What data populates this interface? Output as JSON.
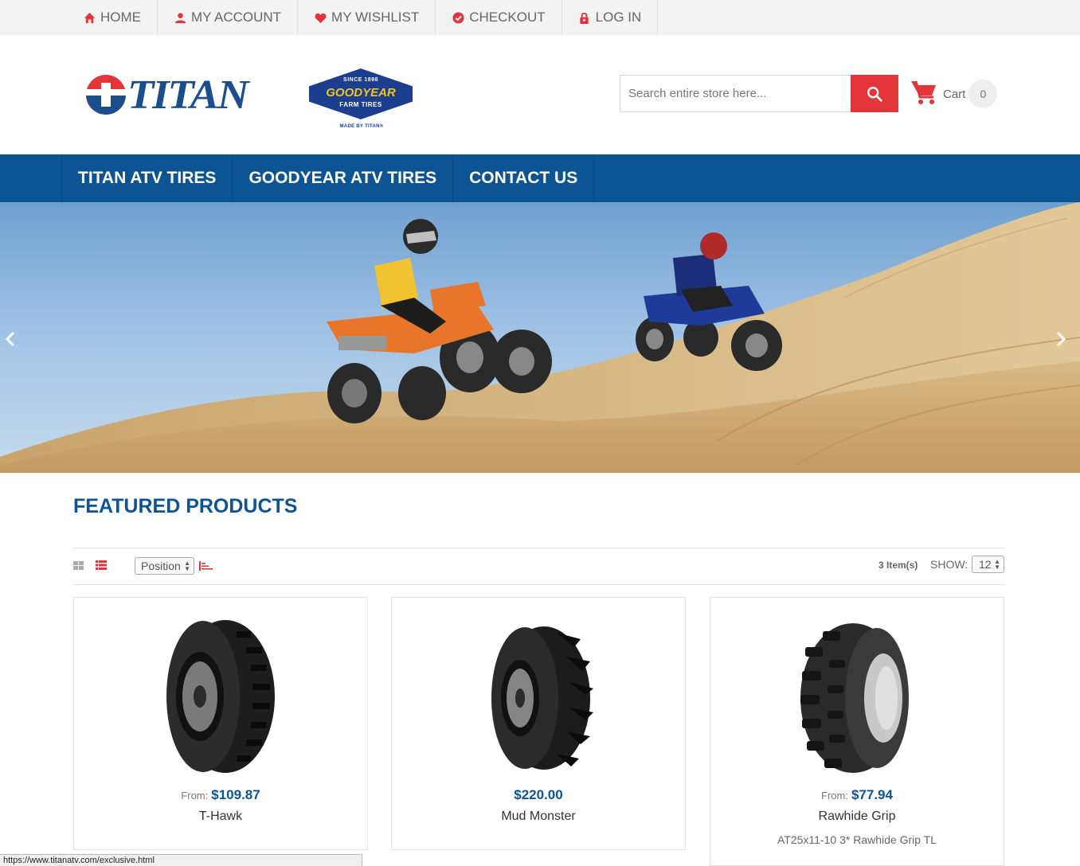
{
  "top_links": [
    {
      "label": "HOME",
      "icon": "home-icon"
    },
    {
      "label": "MY ACCOUNT",
      "icon": "user-icon"
    },
    {
      "label": "MY WISHLIST",
      "icon": "heart-icon"
    },
    {
      "label": "CHECKOUT",
      "icon": "check-circle-icon"
    },
    {
      "label": "LOG IN",
      "icon": "lock-icon"
    }
  ],
  "brand": {
    "titan_logo_text": "TITAN",
    "goodyear_since": "SINCE 1898",
    "goodyear_name": "GOODYEAR",
    "goodyear_farm": "FARM TIRES",
    "goodyear_made_by": "MADE BY TITAN®"
  },
  "search": {
    "placeholder": "Search entire store here...",
    "value": ""
  },
  "cart": {
    "label": "Cart",
    "count": "0"
  },
  "nav": [
    {
      "label": "TITAN ATV TIRES"
    },
    {
      "label": "GOODYEAR ATV TIRES"
    },
    {
      "label": "CONTACT US"
    }
  ],
  "featured": {
    "title": "FEATURED PRODUCTS",
    "sort_value": "Position",
    "items_count": "3 Item(s)",
    "show_label": "SHOW:",
    "limit_value": "12"
  },
  "products": [
    {
      "from_label": "From:",
      "price": "$109.87",
      "name": "T-Hawk",
      "subtitle": ""
    },
    {
      "from_label": "",
      "price": "$220.00",
      "name": "Mud Monster",
      "subtitle": ""
    },
    {
      "from_label": "From:",
      "price": "$77.94",
      "name": "Rawhide Grip",
      "subtitle": "AT25x11-10 3* Rawhide Grip TL"
    }
  ],
  "status_url": "https://www.titanatv.com/exclusive.html",
  "colors": {
    "accent_red": "#e3343a",
    "brand_blue": "#0d5494"
  }
}
